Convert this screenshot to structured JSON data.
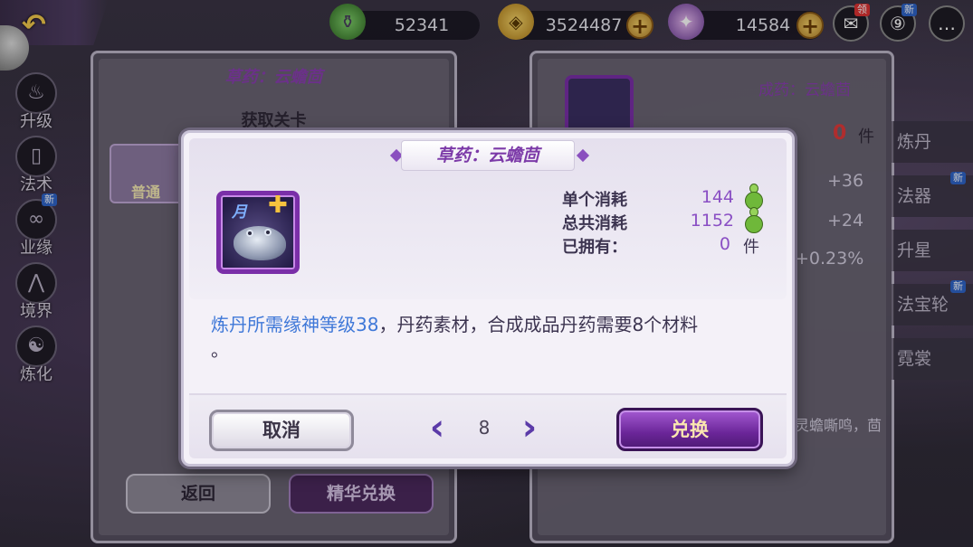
{
  "topbar": {
    "back_label": "↶",
    "stamina": "52341",
    "coins": "3524487",
    "gems": "14584",
    "plus": "+",
    "gift_badge": "领",
    "new_badge": "新"
  },
  "left_nav": [
    {
      "label": "升级",
      "icon": "upgrade-icon"
    },
    {
      "label": "法术",
      "icon": "spell-icon"
    },
    {
      "label": "业缘",
      "icon": "karma-icon",
      "badge": "新"
    },
    {
      "label": "境界",
      "icon": "realm-icon"
    },
    {
      "label": "炼化",
      "icon": "refine-icon"
    }
  ],
  "left_panel": {
    "title": "草药：云蟾茴",
    "section": "获取关卡",
    "stage_tag": "普通",
    "back_button": "返回",
    "essence_button": "精华兑换"
  },
  "right_panel": {
    "title": "成药：云蟾茴",
    "owned_label": "已拥有：",
    "owned_value": "0",
    "owned_unit": "件",
    "stats": [
      "+36",
      "+24",
      "+0.23%"
    ],
    "lore": "灵蟾嘶鸣，茴"
  },
  "right_menu": [
    {
      "label": "炼丹"
    },
    {
      "label": "法器",
      "badge": "新"
    },
    {
      "label": "升星"
    },
    {
      "label": "法宝轮",
      "badge": "新"
    },
    {
      "label": "霓裳"
    }
  ],
  "dialog": {
    "title": "草药：云蟾茴",
    "item_tag": "月",
    "single_cost_label": "单个消耗",
    "single_cost_value": "144",
    "total_cost_label": "总共消耗",
    "total_cost_value": "1152",
    "owned_label": "已拥有：",
    "owned_value": "0",
    "owned_unit": "件",
    "desc_highlight": "炼丹所需缘神等级38",
    "desc_rest": "，丹药素材，合成成品丹药需要8个材料",
    "desc_end": "。",
    "quantity": "8",
    "cancel_button": "取消",
    "exchange_button": "兑换"
  }
}
